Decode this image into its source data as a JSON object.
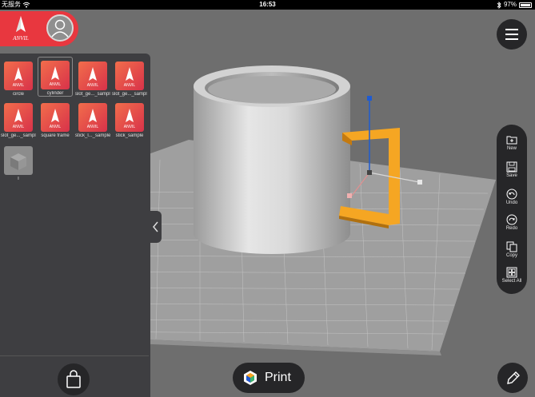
{
  "status_bar": {
    "carrier": "无服务",
    "time": "16:53",
    "battery_pct": "97%",
    "battery_level": 0.97,
    "icons": [
      "wifi-icon",
      "bluetooth-icon",
      "battery-icon"
    ]
  },
  "brand": {
    "logo_text": "ANVIL",
    "accent_color": "#e8373f"
  },
  "library": {
    "items": [
      {
        "label": "circle",
        "type": "anvil"
      },
      {
        "label": "cylinder",
        "type": "anvil",
        "selected": true
      },
      {
        "label": "slot_ge..._sample",
        "type": "anvil"
      },
      {
        "label": "slot_ge..._sample",
        "type": "anvil"
      },
      {
        "label": "slot_ge..._sample",
        "type": "anvil"
      },
      {
        "label": "square frame",
        "type": "anvil"
      },
      {
        "label": "stick_l..._sample",
        "type": "anvil"
      },
      {
        "label": "stick_sample",
        "type": "anvil"
      },
      {
        "label": "T",
        "type": "plain"
      }
    ]
  },
  "toolbar": {
    "new_label": "New",
    "save_label": "Save",
    "undo_label": "Undo",
    "redo_label": "Redo",
    "copy_label": "Copy",
    "select_all_label": "Select All"
  },
  "print": {
    "label": "Print"
  },
  "colors": {
    "panel": "#3e3e41",
    "button": "#262628",
    "viewport": "#6e6e6e",
    "handle": "#f5a623",
    "axis_blue": "#1f5bd1"
  }
}
